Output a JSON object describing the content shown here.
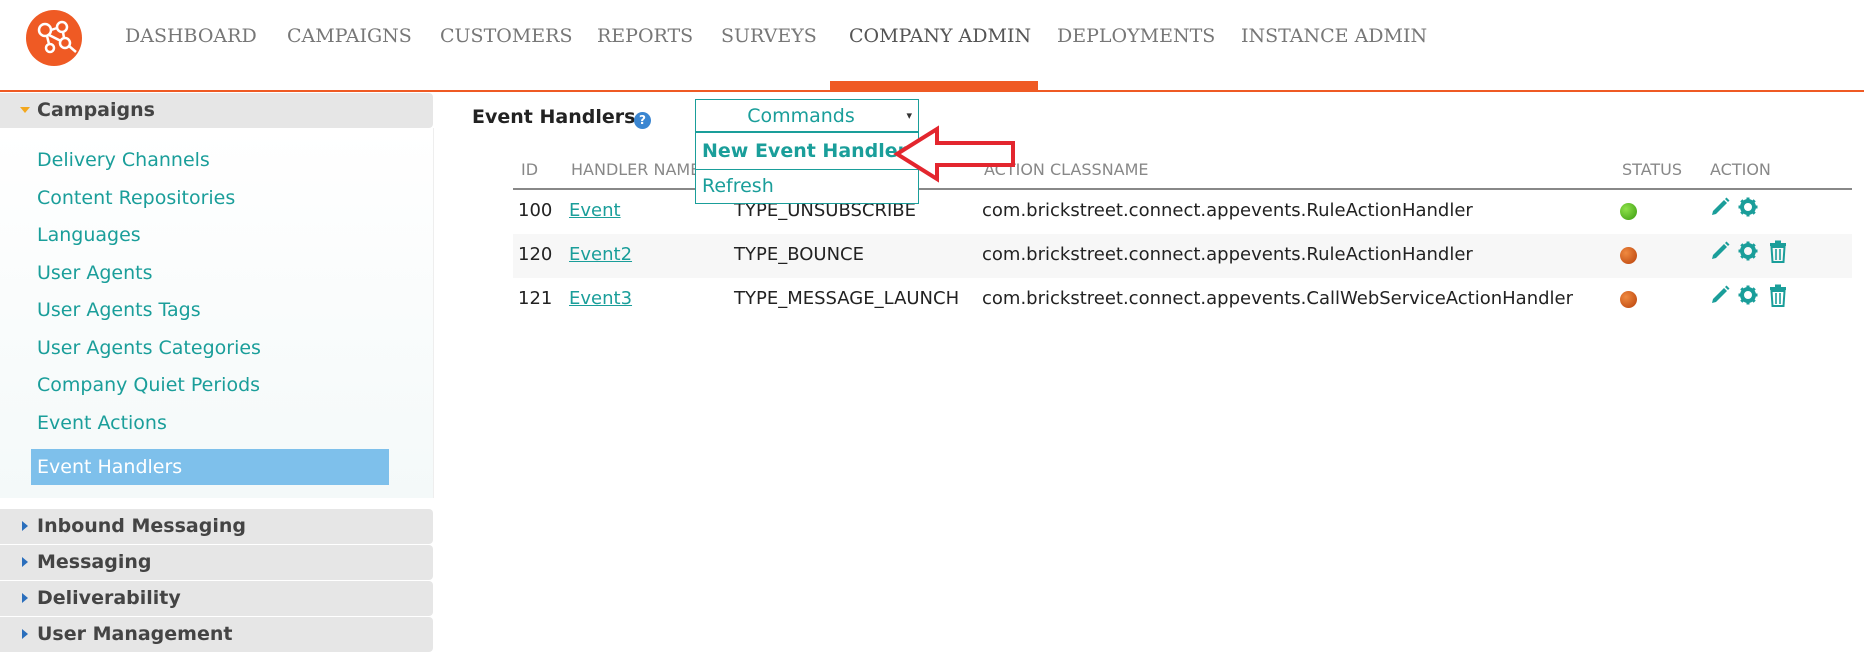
{
  "nav": {
    "items": [
      "DASHBOARD",
      "CAMPAIGNS",
      "CUSTOMERS",
      "REPORTS",
      "SURVEYS",
      "COMPANY ADMIN",
      "DEPLOYMENTS",
      "INSTANCE ADMIN"
    ],
    "active": "COMPANY ADMIN"
  },
  "sidebar": {
    "sections": {
      "campaigns": "Campaigns",
      "inbound": "Inbound Messaging",
      "messaging": "Messaging",
      "deliverability": "Deliverability",
      "user_management": "User Management"
    },
    "campaign_items": [
      "Delivery Channels",
      "Content Repositories",
      "Languages",
      "User Agents",
      "User Agents Tags",
      "User Agents Categories",
      "Company Quiet Periods",
      "Event Actions",
      "Event Handlers"
    ],
    "selected_item": "Event Handlers"
  },
  "main": {
    "title": "Event Handlers",
    "info_icon": "?",
    "commands": {
      "label": "Commands",
      "caret": "▾",
      "items": [
        "New Event Handler",
        "Refresh"
      ]
    }
  },
  "table": {
    "headers": [
      "ID",
      "HANDLER NAME",
      "ACTION CLASSNAME",
      "STATUS",
      "ACTION"
    ],
    "rows": [
      {
        "id": "100",
        "name": "Event",
        "type": "TYPE_UNSUBSCRIBE",
        "classname": "com.brickstreet.connect.appevents.RuleActionHandler",
        "status": "green",
        "actions": [
          "edit",
          "settings"
        ]
      },
      {
        "id": "120",
        "name": "Event2",
        "type": "TYPE_BOUNCE",
        "classname": "com.brickstreet.connect.appevents.RuleActionHandler",
        "status": "red",
        "actions": [
          "edit",
          "settings",
          "delete"
        ]
      },
      {
        "id": "121",
        "name": "Event3",
        "type": "TYPE_MESSAGE_LAUNCH",
        "classname": "com.brickstreet.connect.appevents.CallWebServiceActionHandler",
        "status": "red",
        "actions": [
          "edit",
          "settings",
          "delete"
        ]
      }
    ]
  },
  "colors": {
    "accent": "#ef5a24",
    "teal": "#1a9e9a",
    "selected": "#7ec0eb",
    "status_green": "#3a9a10",
    "status_red": "#b8400a",
    "callout_arrow": "#e3262e"
  }
}
